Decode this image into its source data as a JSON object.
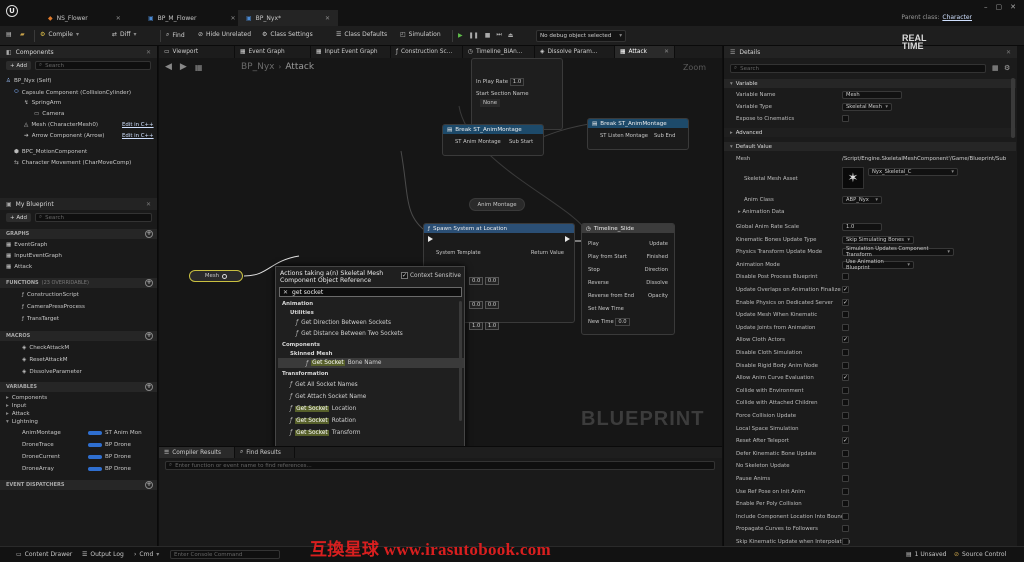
{
  "tabs": [
    {
      "label": "NS_Flower"
    },
    {
      "label": "BP_M_Flower"
    },
    {
      "label": "BP_Nyx*"
    }
  ],
  "parent_class": {
    "label": "Parent class:",
    "value": "Character"
  },
  "toolbar": {
    "compile": "Compile",
    "diff": "Diff",
    "find": "Find",
    "hide_unrelated": "Hide Unrelated",
    "class_settings": "Class Settings",
    "class_defaults": "Class Defaults",
    "simulation": "Simulation",
    "debug_filter": "No debug object selected"
  },
  "components": {
    "title": "Components",
    "add": "+ Add",
    "search_placeholder": "Search",
    "items": [
      "BP_Nyx (Self)",
      "Capsule Component (CollisionCylinder)",
      "SpringArm",
      "Camera",
      "Mesh (CharacterMesh0)",
      "Arrow Component (Arrow)",
      "BPC_MotionComponent",
      "Character Movement (CharMoveComp)"
    ],
    "edit_cpp": "Edit in C++"
  },
  "my_blueprint": {
    "title": "My Blueprint",
    "add": "+ Add",
    "search_placeholder": "Search",
    "sections": {
      "graphs": "GRAPHS",
      "functions": "FUNCTIONS",
      "functions_count": "(23 OVERRIDABLE)",
      "macros": "MACROS",
      "variables": "VARIABLES",
      "dispatchers": "EVENT DISPATCHERS"
    },
    "graphs": [
      "EventGraph",
      "InputEventGraph",
      "Attack"
    ],
    "functions": [
      "ConstructionScript",
      "CameraPressProcess",
      "TransTarget"
    ],
    "macros": [
      "CheckAttackM",
      "ResetAttackM",
      "DissolveParameter"
    ],
    "var_categories": [
      "Components",
      "Input",
      "Attack",
      "Lightning"
    ],
    "variables": [
      {
        "name": "AnimMontage",
        "type": "ST Anim Mon",
        "color": "#2f6fd0"
      },
      {
        "name": "DroneTrace",
        "type": "BP Drone",
        "color": "#2f6fd0"
      },
      {
        "name": "DroneCurrent",
        "type": "BP Drone",
        "color": "#2f6fd0"
      },
      {
        "name": "DroneArray",
        "type": "BP Drone",
        "color": "#2f6fd0"
      }
    ]
  },
  "graph_tabs": [
    "Viewport",
    "Event Graph",
    "Input Event Graph",
    "Construction Sc...",
    "Timeline_BiAn...",
    "Dissolve Param...",
    "Attack"
  ],
  "breadcrumb": {
    "root": "BP_Nyx",
    "leaf": "Attack"
  },
  "zoom": "Zoom",
  "watermark_text": "BLUEPRINT",
  "nodes": {
    "top_play": {
      "label": "In Play Rate",
      "value": "1.0",
      "section": "Start Section Name",
      "section_value": "None"
    },
    "break1": {
      "title": "Break ST_AnimMontage",
      "out1": "ST Anim Montage",
      "out2": "Sub Start"
    },
    "break2": {
      "title": "Break ST_AnimMontage",
      "out1": "ST Listen Montage",
      "out2": "Sub End"
    },
    "anim_montage": {
      "label": "Anim Montage"
    },
    "spawn": {
      "title": "Spawn System at Location",
      "in": "System Template",
      "out": "Return Value"
    },
    "timeline": {
      "title": "Timeline_Slide",
      "pins": [
        "Play",
        "Play from Start",
        "Stop",
        "Reverse",
        "Reverse from End",
        "Set New Time",
        "New Time"
      ],
      "outs": [
        "Update",
        "Finished",
        "Direction",
        "Dissolve",
        "Opacity"
      ],
      "new_time": "0.0"
    },
    "mesh": {
      "label": "Mesh"
    },
    "vec_values": [
      "0.0",
      "0.0",
      "0.0",
      "0.0",
      "1.0",
      "1.0"
    ]
  },
  "menu": {
    "title": "Actions taking a(n) Skeletal Mesh Component Object Reference",
    "context": "Context Sensitive",
    "search_value": "get socket",
    "categories": [
      "Animation",
      "Utilities",
      "Components",
      "Skinned Mesh",
      "Transformation"
    ],
    "items_anim": [
      "Get Direction Between Sockets",
      "Get Distance Between Two Sockets"
    ],
    "item_bone": {
      "hl": "Get Socket",
      "rest": "Bone Name"
    },
    "items_trans": [
      "Get All Socket Names",
      "Get Attach Socket Name"
    ],
    "items_hl": [
      {
        "hl": "Get Socket",
        "rest": "Location"
      },
      {
        "hl": "Get Socket",
        "rest": "Rotation"
      },
      {
        "hl": "Get Socket",
        "rest": "Transform"
      }
    ]
  },
  "bottom": {
    "compiler_results": "Compiler Results",
    "find_results": "Find Results",
    "search_placeholder": "Enter function or event name to find references..."
  },
  "details": {
    "title": "Details",
    "search_placeholder": "Search",
    "section_variable": "Variable",
    "variable_name_label": "Variable Name",
    "variable_name": "Mesh",
    "variable_type_label": "Variable Type",
    "variable_type": "Skeletal Mesh",
    "expose_label": "Expose to Cinematics",
    "advanced": "Advanced",
    "default_value": "Default Value",
    "mesh_label": "Mesh",
    "mesh_path": "/Script/Engine.SkeletalMeshComponent'/Game/Blueprint/Sub",
    "skel_asset_label": "Skeletal Mesh Asset",
    "skel_asset": "Nyx_Skeletal_C",
    "anim_class_label": "Anim Class",
    "anim_class": "ABP_Nyx",
    "anim_data_label": "Animation Data",
    "props": [
      {
        "label": "Global Anim Rate Scale",
        "value": "1.0",
        "kind": "num"
      },
      {
        "label": "Kinematic Bones Update Type",
        "value": "Skip Simulating Bones",
        "kind": "drop"
      },
      {
        "label": "Physics Transform Update Mode",
        "value": "Simulation Updates Component Transform",
        "kind": "drop"
      },
      {
        "label": "Animation Mode",
        "value": "Use Animation Blueprint",
        "kind": "drop"
      },
      {
        "label": "Disable Post Process Blueprint",
        "value": "",
        "kind": "chk",
        "checked": false
      },
      {
        "label": "Update Overlaps on Animation Finalize",
        "value": "",
        "kind": "chk",
        "checked": true
      },
      {
        "label": "Enable Physics on Dedicated Server",
        "value": "",
        "kind": "chk",
        "checked": true
      },
      {
        "label": "Update Mesh When Kinematic",
        "value": "",
        "kind": "chk",
        "checked": false
      },
      {
        "label": "Update Joints from Animation",
        "value": "",
        "kind": "chk",
        "checked": false
      },
      {
        "label": "Allow Cloth Actors",
        "value": "",
        "kind": "chk",
        "checked": true
      },
      {
        "label": "Disable Cloth Simulation",
        "value": "",
        "kind": "chk",
        "checked": false
      },
      {
        "label": "Disable Rigid Body Anim Node",
        "value": "",
        "kind": "chk",
        "checked": false
      },
      {
        "label": "Allow Anim Curve Evaluation",
        "value": "",
        "kind": "chk",
        "checked": true
      },
      {
        "label": "Collide with Environment",
        "value": "",
        "kind": "chk",
        "checked": false
      },
      {
        "label": "Collide with Attached Children",
        "value": "",
        "kind": "chk",
        "checked": false
      },
      {
        "label": "Force Collision Update",
        "value": "",
        "kind": "chk",
        "checked": false
      },
      {
        "label": "Local Space Simulation",
        "value": "",
        "kind": "chk",
        "checked": false
      },
      {
        "label": "Reset After Teleport",
        "value": "",
        "kind": "chk",
        "checked": true
      },
      {
        "label": "Defer Kinematic Bone Update",
        "value": "",
        "kind": "chk",
        "checked": false
      },
      {
        "label": "No Skeleton Update",
        "value": "",
        "kind": "chk",
        "checked": false
      },
      {
        "label": "Pause Anims",
        "value": "",
        "kind": "chk",
        "checked": false
      },
      {
        "label": "Use Ref Pose on Init Anim",
        "value": "",
        "kind": "chk",
        "checked": false
      },
      {
        "label": "Enable Per Poly Collision",
        "value": "",
        "kind": "chk",
        "checked": false
      },
      {
        "label": "Include Component Location Into Bounds",
        "value": "",
        "kind": "chk",
        "checked": false
      },
      {
        "label": "Propagate Curves to Followers",
        "value": "",
        "kind": "chk",
        "checked": false
      },
      {
        "label": "Skip Kinematic Update when Interpolating",
        "value": "",
        "kind": "chk",
        "checked": false
      }
    ]
  },
  "status": {
    "content_drawer": "Content Drawer",
    "output_log": "Output Log",
    "cmd": "Cmd",
    "cmd_placeholder": "Enter Console Command",
    "unsaved": "1 Unsaved",
    "source_control": "Source Control"
  },
  "logo_text": "REAL TIME",
  "site_watermark": "互換星球 www.irasutobook.com"
}
